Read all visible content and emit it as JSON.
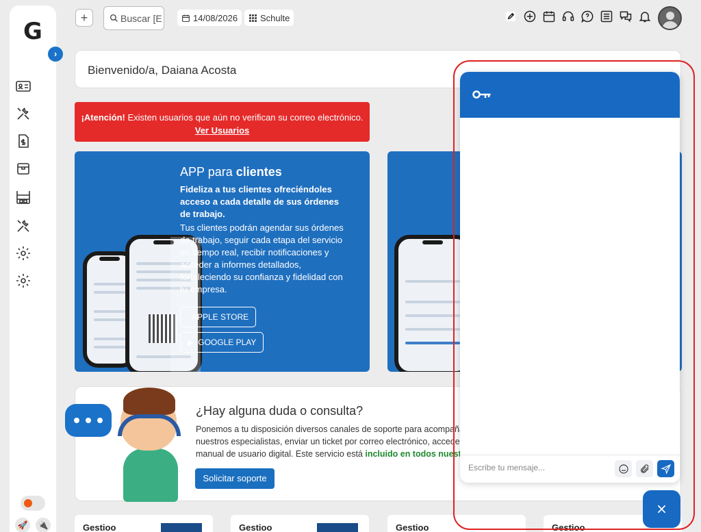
{
  "app": {
    "logo": "G"
  },
  "sidebar": {
    "items": [
      {
        "name": "id-card-icon"
      },
      {
        "name": "tools-icon"
      },
      {
        "name": "invoice-icon"
      },
      {
        "name": "box-icon"
      },
      {
        "name": "shelves-icon"
      },
      {
        "name": "tools-icon"
      },
      {
        "name": "gear-icon"
      },
      {
        "name": "gear-icon"
      }
    ]
  },
  "topbar": {
    "add_label": "+",
    "search_placeholder": "Buscar [E",
    "date": "14/08/2026",
    "company": "Schulte"
  },
  "welcome": {
    "text": "Bienvenido/a, Daiana Acosta"
  },
  "alert": {
    "bold": "¡Atención!",
    "text": " Existen usuarios que aún no verifican su correo electrónico.",
    "link": "Ver Usuarios",
    "color": "#e52a2a"
  },
  "app_card": {
    "title_pre": "APP para ",
    "title_bold": "clientes",
    "lead": "Fideliza a tus clientes ofreciéndoles acceso a cada detalle de sus órdenes de trabajo.",
    "body": "Tus clientes podrán agendar sus órdenes de trabajo, seguir cada etapa del servicio en tiempo real, recibir notificaciones y acceder a informes detallados, fortaleciendo su confianza y fidelidad con tu empresa.",
    "apple": "APPLE STORE",
    "google": "GOOGLE PLAY",
    "color": "#1f6fbf"
  },
  "support": {
    "title": "¿Hay alguna duda o consulta?",
    "line1": "Ponemos a tu disposición diversos canales de soporte para acompaña",
    "line2": "nuestros especialistas, enviar un ticket por correo electrónico, acceder",
    "line3_pre": "manual de usuario digital. Este servicio está ",
    "line3_green": "incluido en todos nuestr",
    "button": "Solicitar soporte"
  },
  "bottom_cards": [
    {
      "label": "Gestioo"
    },
    {
      "label": "Gestioo"
    },
    {
      "label": "Gestioo"
    },
    {
      "label": "Gestioo"
    }
  ],
  "chat": {
    "placeholder": "Escribe tu mensaje...",
    "close": "×",
    "accent": "#1769c2"
  }
}
